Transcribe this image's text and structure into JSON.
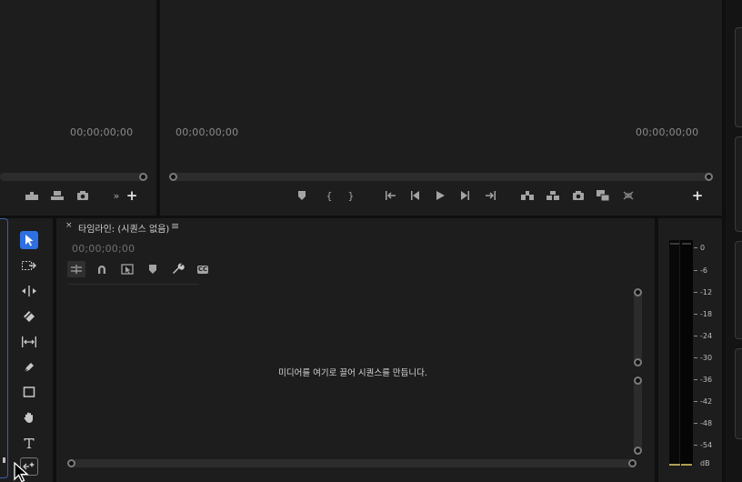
{
  "source_monitor": {
    "timecode": "00;00;00;00"
  },
  "program_monitor": {
    "timecode_left": "00;00;00;00",
    "timecode_right": "00;00;00;00"
  },
  "timeline": {
    "close_label": "×",
    "title": "타임라인: (시퀀스 없음)",
    "menu_label": "≡",
    "timecode": "00;00;00;00",
    "empty_message": "미디어를 여기로 끌어 시퀀스를 만듭니다.",
    "toolbar_icons": [
      "nest-icon",
      "snap-magnet-icon",
      "linked-selection-icon",
      "add-marker-icon",
      "timeline-settings-wrench-icon",
      "captions-cc-icon"
    ],
    "cc_label": "CC"
  },
  "tools": [
    {
      "name": "selection-tool-icon",
      "active": true
    },
    {
      "name": "track-select-forward-tool-icon",
      "active": false
    },
    {
      "name": "ripple-edit-tool-icon",
      "active": false
    },
    {
      "name": "razor-tool-icon",
      "active": false
    },
    {
      "name": "slip-tool-icon",
      "active": false
    },
    {
      "name": "pen-tool-icon",
      "active": false
    },
    {
      "name": "rectangle-tool-icon",
      "active": false
    },
    {
      "name": "hand-tool-icon",
      "active": false
    },
    {
      "name": "type-tool-icon",
      "active": false
    },
    {
      "name": "generative-extend-tool-icon",
      "active": false
    }
  ],
  "audio_meter": {
    "scale": [
      "0",
      "-6",
      "-12",
      "-18",
      "-24",
      "-30",
      "-36",
      "-42",
      "-48",
      "-54",
      "dB"
    ],
    "level_color": "#b0a050"
  },
  "colors": {
    "accent": "#2e6fe2",
    "panel_bg": "#1d1d1d",
    "gap_bg": "#0f0f0f"
  }
}
